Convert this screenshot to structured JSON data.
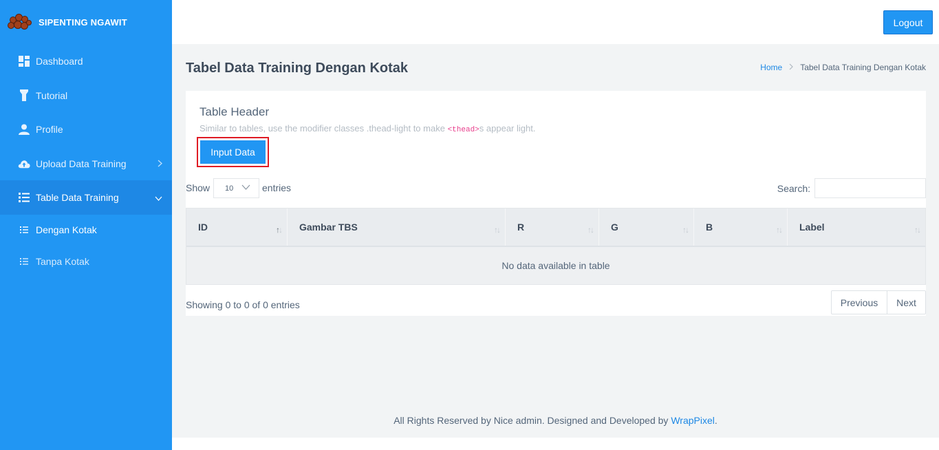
{
  "app": {
    "brand_title": "SIPENTING NGAWIT"
  },
  "topbar": {
    "logout_label": "Logout"
  },
  "sidebar": {
    "items": [
      {
        "label": "Dashboard",
        "icon": "dashboard-icon"
      },
      {
        "label": "Tutorial",
        "icon": "flashlight-icon"
      },
      {
        "label": "Profile",
        "icon": "user-icon"
      },
      {
        "label": "Upload Data Training",
        "icon": "cloud-upload-icon"
      },
      {
        "label": "Table Data Training",
        "icon": "list-icon"
      }
    ],
    "subitems": [
      {
        "label": "Dengan Kotak",
        "icon": "list-icon"
      },
      {
        "label": "Tanpa Kotak",
        "icon": "list-icon"
      }
    ]
  },
  "page": {
    "title": "Tabel Data Training Dengan Kotak",
    "breadcrumb": {
      "home": "Home",
      "current": "Tabel Data Training Dengan Kotak"
    }
  },
  "card": {
    "title": "Table Header",
    "subtitle_before": "Similar to tables, use the modifier classes .thead-light to make ",
    "subtitle_code": "<thead>",
    "subtitle_after": "s appear light.",
    "input_button": "Input Data"
  },
  "datatable": {
    "show_label": "Show",
    "page_length": "10",
    "entries_label": "entries",
    "search_label": "Search:",
    "columns": [
      "ID",
      "Gambar TBS",
      "R",
      "G",
      "B",
      "Label"
    ],
    "empty_message": "No data available in table",
    "info": "Showing 0 to 0 of 0 entries",
    "previous": "Previous",
    "next": "Next"
  },
  "footer": {
    "text": "All Rights Reserved by Nice admin. Designed and Developed by ",
    "link": "WrapPixel",
    "suffix": "."
  },
  "colors": {
    "primary": "#2196f3",
    "sidebar_active": "#1e88e5",
    "highlight_border": "#e01b24"
  }
}
